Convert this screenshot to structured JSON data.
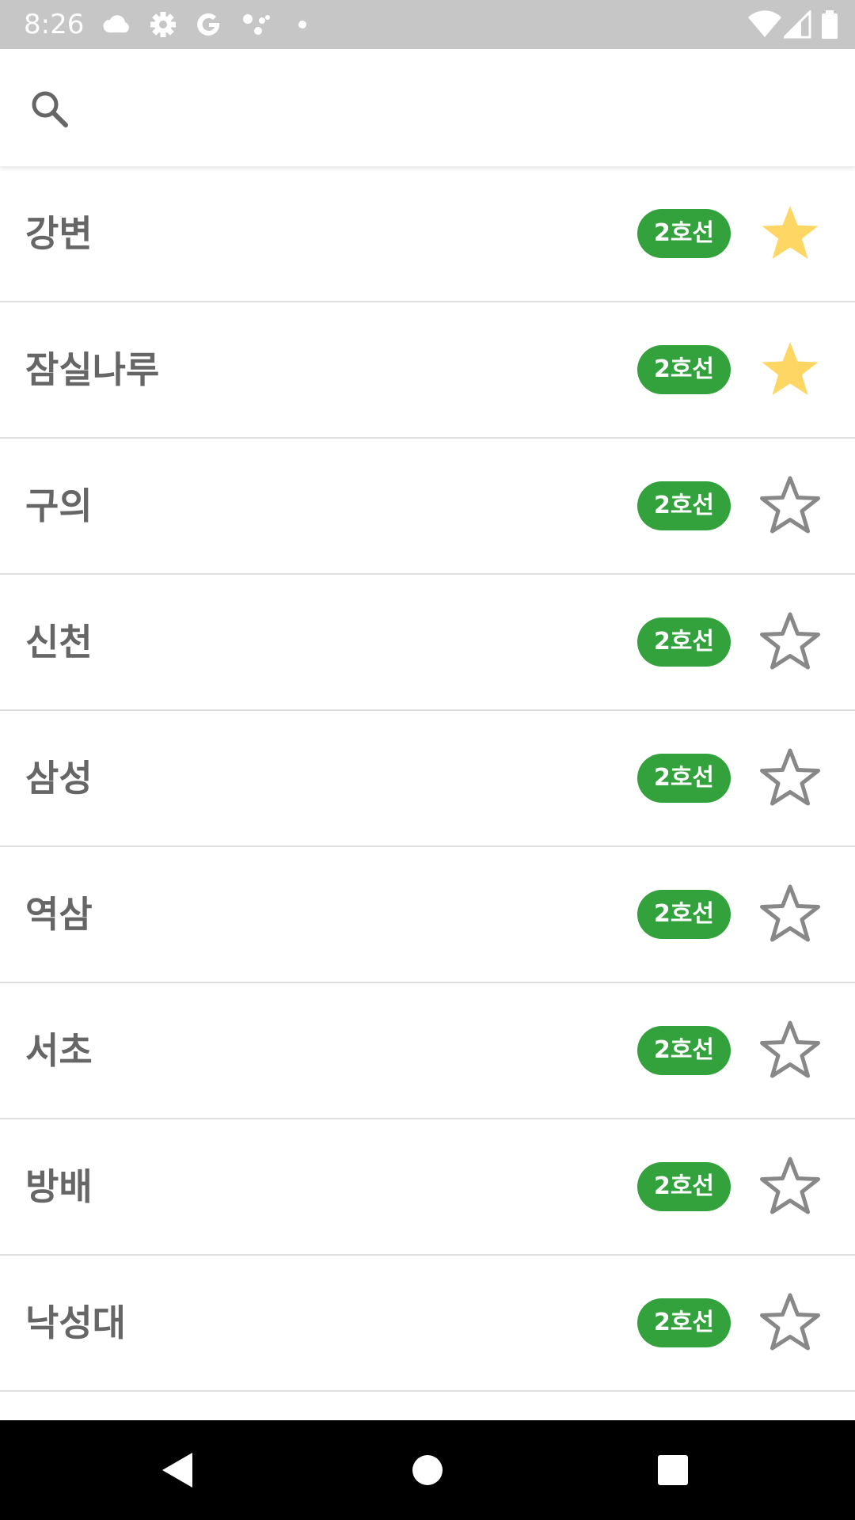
{
  "status_bar": {
    "time": "8:26",
    "icons_left": [
      "cloud-icon",
      "settings-icon",
      "google-icon",
      "assistant-dots-icon",
      "dot-icon"
    ],
    "icons_right": [
      "wifi-icon",
      "signal-icon",
      "battery-icon"
    ]
  },
  "search": {
    "value": "",
    "placeholder": "",
    "icon": "search-icon"
  },
  "colors": {
    "line_2_green": "#33a23d",
    "favorite_star": "#fdd663",
    "empty_star_outline": "#888888",
    "station_text": "#666666",
    "status_bar_bg": "#c6c6c6"
  },
  "stations": [
    {
      "name": "강변",
      "line": "2호선",
      "favorite": true
    },
    {
      "name": "잠실나루",
      "line": "2호선",
      "favorite": true
    },
    {
      "name": "구의",
      "line": "2호선",
      "favorite": false
    },
    {
      "name": "신천",
      "line": "2호선",
      "favorite": false
    },
    {
      "name": "삼성",
      "line": "2호선",
      "favorite": false
    },
    {
      "name": "역삼",
      "line": "2호선",
      "favorite": false
    },
    {
      "name": "서초",
      "line": "2호선",
      "favorite": false
    },
    {
      "name": "방배",
      "line": "2호선",
      "favorite": false
    },
    {
      "name": "낙성대",
      "line": "2호선",
      "favorite": false
    }
  ],
  "nav_bar": {
    "buttons": [
      "back-icon",
      "home-icon",
      "recents-icon"
    ]
  }
}
